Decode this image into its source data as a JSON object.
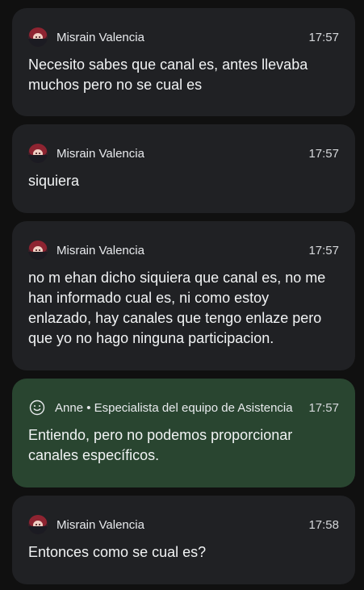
{
  "messages": [
    {
      "sender": "Misrain Valencia",
      "time": "17:57",
      "text": "Necesito sabes que canal es, antes llevaba muchos pero no se cual es",
      "avatar_icon": "user-avatar-icon"
    },
    {
      "sender": "Misrain Valencia",
      "time": "17:57",
      "text": "siquiera",
      "avatar_icon": "user-avatar-icon"
    },
    {
      "sender": "Misrain Valencia",
      "time": "17:57",
      "text": "no m ehan dicho siquiera que canal es, no me han informado cual es, ni como estoy enlazado, hay canales que tengo enlaze pero que yo no hago ninguna participacion.",
      "avatar_icon": "user-avatar-icon"
    },
    {
      "sender": "Anne • Especialista del equipo de Asistencia",
      "time": "17:57",
      "text": "Entiendo, pero no podemos proporcionar canales específicos.",
      "avatar_icon": "smiley-icon"
    },
    {
      "sender": "Misrain Valencia",
      "time": "17:58",
      "text": "Entonces como se cual es?",
      "avatar_icon": "user-avatar-icon"
    }
  ],
  "colors": {
    "background": "#101010",
    "user_card": "#202124",
    "agent_card": "#294530",
    "text": "#f1f3f4"
  }
}
